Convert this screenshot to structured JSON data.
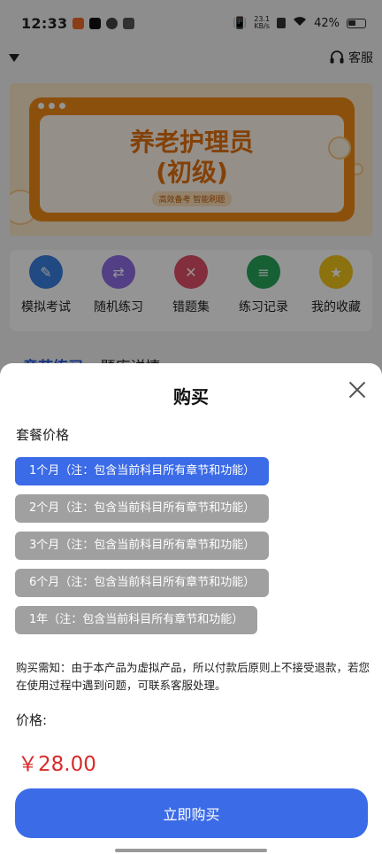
{
  "status_bar": {
    "time": "12:33",
    "net_speed_value": "23.1",
    "net_speed_unit": "KB/s",
    "battery": "42%"
  },
  "header": {
    "service_label": "客服"
  },
  "banner": {
    "title_line1": "养老护理员",
    "title_line2": "(初级)",
    "tagline": "高效备考 智能刷题"
  },
  "quick_nav": [
    {
      "label": "模拟考试",
      "icon": "exam-icon",
      "color": "#3a7fe0"
    },
    {
      "label": "随机练习",
      "icon": "shuffle-icon",
      "color": "#8e6de6"
    },
    {
      "label": "错题集",
      "icon": "wrong-questions-icon",
      "color": "#e0506a"
    },
    {
      "label": "练习记录",
      "icon": "record-icon",
      "color": "#27a55a"
    },
    {
      "label": "我的收藏",
      "icon": "star-icon",
      "color": "#f0c419"
    }
  ],
  "tabs": {
    "active": "章节练习",
    "other": "题库详情"
  },
  "purchase_sheet": {
    "title": "购买",
    "package_label": "套餐价格",
    "options": [
      {
        "label": "1个月（注：包含当前科目所有章节和功能）",
        "selected": true
      },
      {
        "label": "2个月（注：包含当前科目所有章节和功能）",
        "selected": false
      },
      {
        "label": "3个月（注：包含当前科目所有章节和功能）",
        "selected": false
      },
      {
        "label": "6个月（注：包含当前科目所有章节和功能）",
        "selected": false
      },
      {
        "label": "1年（注：包含当前科目所有章节和功能）",
        "selected": false
      }
    ],
    "notice": "购买需知：由于本产品为虚拟产品，所以付款后原则上不接受退款，若您在使用过程中遇到问题，可联系客服处理。",
    "price_label": "价格:",
    "price_value": "￥28.00",
    "buy_label": "立即购买"
  },
  "colors": {
    "accent": "#3b6be6",
    "price": "#d92a2a",
    "unselected_option": "#a0a0a0"
  }
}
